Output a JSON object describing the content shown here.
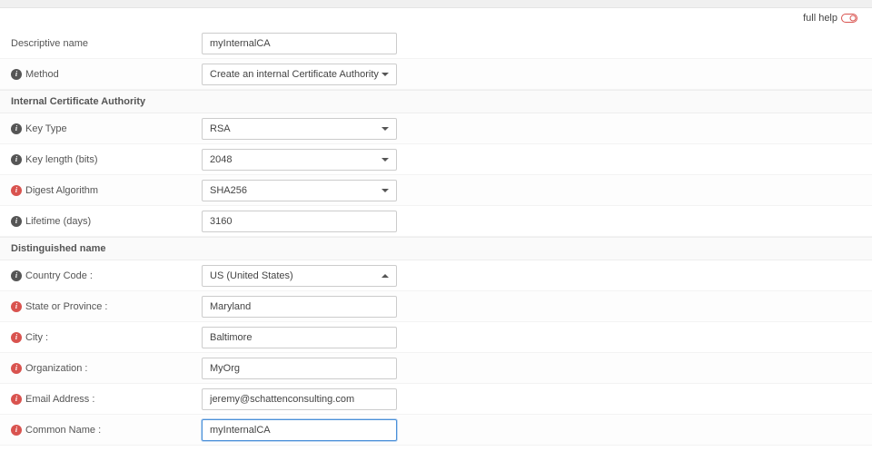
{
  "help_label": "full help",
  "rows": {
    "descriptive_name": {
      "label": "Descriptive name",
      "value": "myInternalCA"
    },
    "method": {
      "label": "Method",
      "value": "Create an internal Certificate Authority"
    },
    "section_ica": {
      "label": "Internal Certificate Authority"
    },
    "key_type": {
      "label": "Key Type",
      "value": "RSA"
    },
    "key_length": {
      "label": "Key length (bits)",
      "value": "2048"
    },
    "digest": {
      "label": "Digest Algorithm",
      "value": "SHA256"
    },
    "lifetime": {
      "label": "Lifetime (days)",
      "value": "3160"
    },
    "section_dn": {
      "label": "Distinguished name"
    },
    "country": {
      "label": "Country Code :",
      "value": "US (United States)"
    },
    "state": {
      "label": "State or Province :",
      "value": "Maryland"
    },
    "city": {
      "label": "City :",
      "value": "Baltimore"
    },
    "org": {
      "label": "Organization :",
      "value": "MyOrg"
    },
    "email": {
      "label": "Email Address :",
      "value": "jeremy@schattenconsulting.com"
    },
    "cn": {
      "label": "Common Name :",
      "value": "myInternalCA"
    }
  }
}
